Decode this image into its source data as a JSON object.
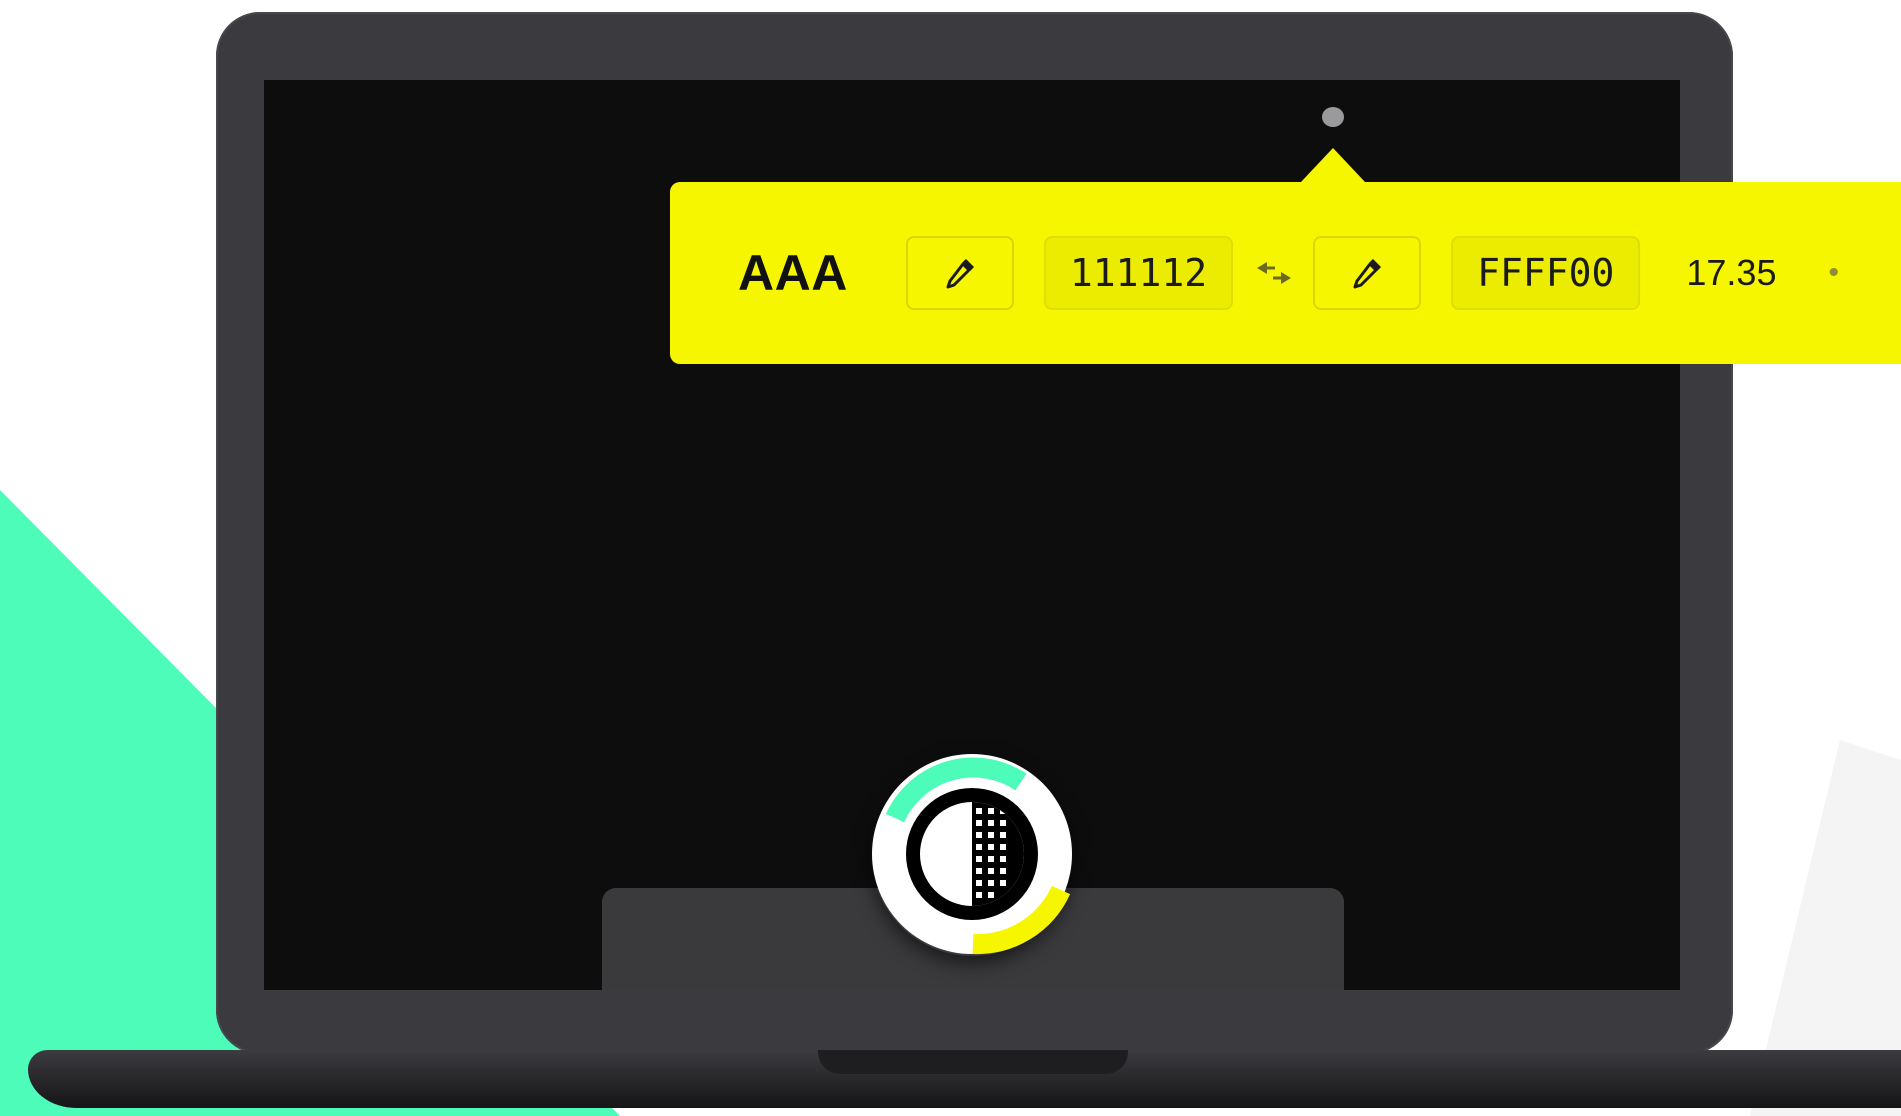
{
  "contrast_popup": {
    "rating": "AAA",
    "foreground_hex": "111112",
    "background_hex": "FFFF00",
    "contrast_ratio": "17.35",
    "foreground_picker_icon": "eyedropper-icon",
    "background_picker_icon": "eyedropper-icon",
    "swap_icon": "swap-arrows-icon"
  },
  "colors": {
    "popup_background": "#f6f600",
    "accent_teal": "#4dfcb9",
    "accent_yellow": "#f6f600",
    "screen_background": "#0d0d0e",
    "laptop_body": "#3b3b3f"
  },
  "app_icon": "contrast-app-icon"
}
